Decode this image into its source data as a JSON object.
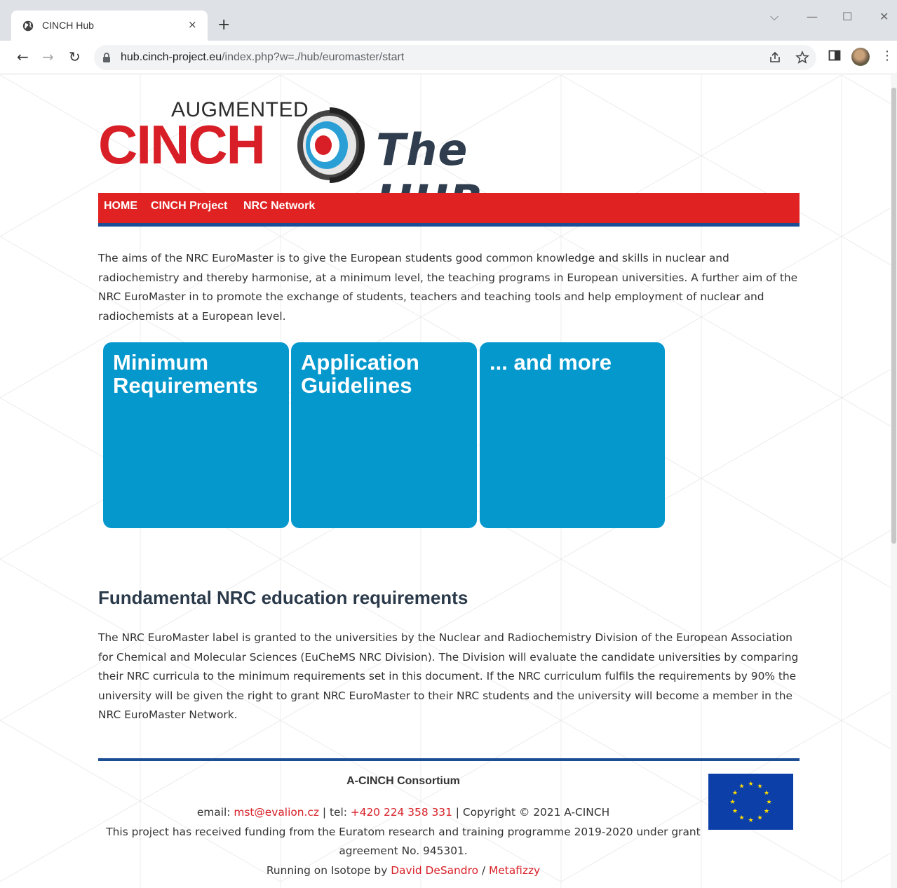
{
  "browser": {
    "tab_title": "CINCH Hub",
    "tab_close": "×",
    "new_tab": "+",
    "url_host": "hub.cinch-project.eu",
    "url_path": "/index.php?w=./hub/euromaster/start",
    "window_controls": {
      "dropdown": "⌵",
      "minimize": "—",
      "maximize": "☐",
      "close": "✕"
    },
    "nav": {
      "back": "←",
      "forward": "→",
      "reload": "↻"
    },
    "icons": [
      "globe-icon",
      "lock-icon",
      "share-icon",
      "star-icon",
      "side-panel-icon",
      "profile-avatar",
      "more-icon"
    ]
  },
  "logo": {
    "augmented": "AUGMENTED",
    "cinch": "CINCH",
    "hub": "The HUB",
    "colors": {
      "red": "#d81e26",
      "dark": "#2f3d4e"
    }
  },
  "nav": {
    "items": [
      {
        "label": "HOME"
      },
      {
        "label": "CINCH Project"
      },
      {
        "label": "NRC Network"
      }
    ],
    "colors": {
      "bar": "#e02222",
      "border": "#1c4e96"
    }
  },
  "intro": "The aims of the NRC EuroMaster is to give the European students good common knowledge and skills in nuclear and radiochemistry and thereby harmonise, at a minimum level, the teaching programs in European universities. A further aim of the NRC EuroMaster in to promote the exchange of students, teachers and teaching tools and help employment of nuclear and radiochemists at a European level.",
  "tiles": [
    {
      "title": "Minimum Requirements"
    },
    {
      "title": "Application Guidelines"
    },
    {
      "title": "... and more"
    }
  ],
  "tile_color": "#0598cd",
  "section": {
    "heading": "Fundamental NRC education requirements",
    "text": "The NRC EuroMaster label is granted to the universities by the Nuclear and Radiochemistry Division of the European Association for Chemical and Molecular Sciences (EuCheMS NRC Division). The Division will evaluate the candidate universities by comparing their NRC curricula to the minimum requirements set in this document. If the NRC curriculum fulfils the requirements by 90% the university will be given the right to grant NRC EuroMaster to their NRC students and the university will become a member in the NRC EuroMaster Network."
  },
  "footer": {
    "org": "A-CINCH Consortium",
    "email_label": "email: ",
    "email": "mst@evalion.cz",
    "tel_label": " | tel: ",
    "tel": "+420 224 358 331",
    "copyright": " | Copyright © 2021 A-CINCH",
    "funding": "This project has received funding from the Euratom research and training programme 2019-2020 under grant agreement No. 945301.",
    "running": "Running on Isotope by ",
    "author": "David DeSandro",
    "separator": " / ",
    "company": "Metafizzy",
    "flag": "eu-flag"
  }
}
